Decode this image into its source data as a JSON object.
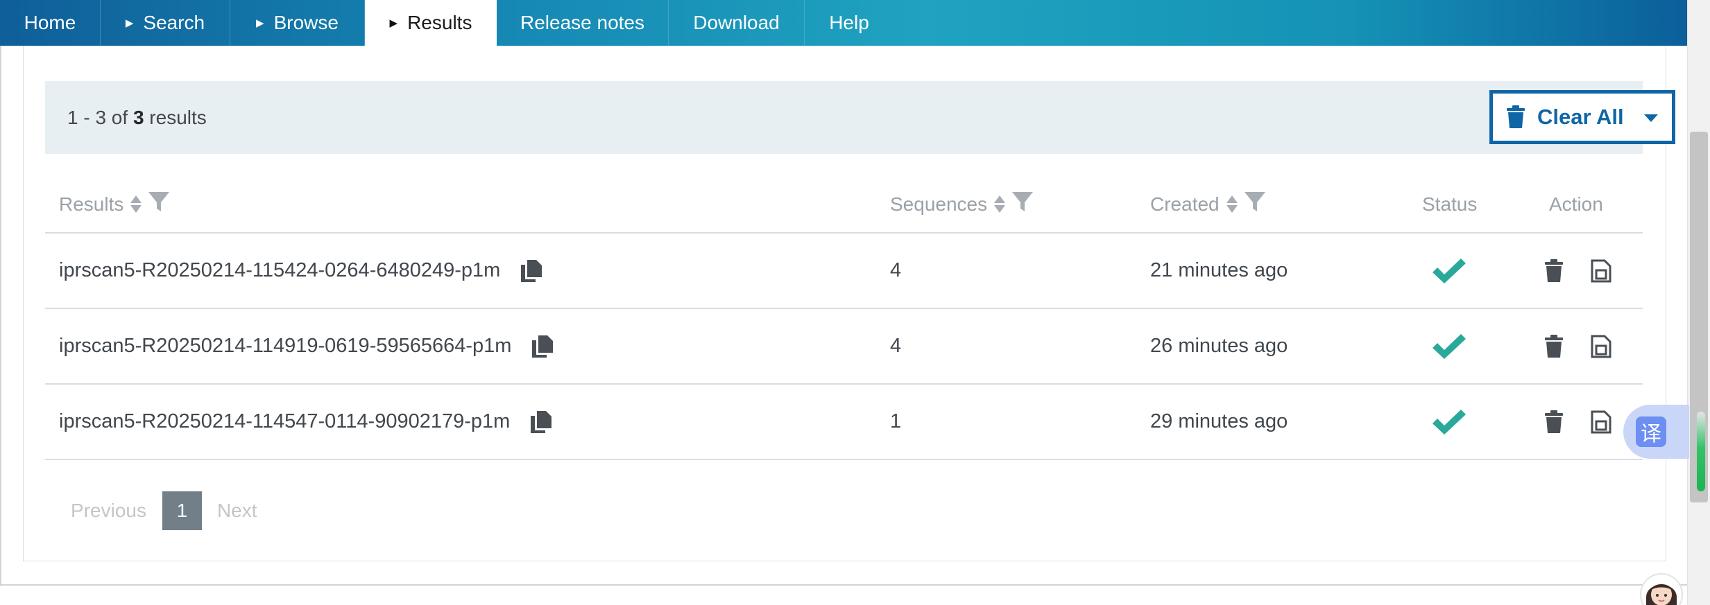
{
  "nav": {
    "items": [
      {
        "label": "Home",
        "has_arrow": false
      },
      {
        "label": "Search",
        "has_arrow": true
      },
      {
        "label": "Browse",
        "has_arrow": true
      },
      {
        "label": "Results",
        "has_arrow": true,
        "active": true
      },
      {
        "label": "Release notes",
        "has_arrow": false
      },
      {
        "label": "Download",
        "has_arrow": false
      },
      {
        "label": "Help",
        "has_arrow": false
      }
    ]
  },
  "summary": {
    "range_prefix": "1 - 3 of ",
    "total": "3",
    "suffix": " results",
    "clear_all_label": "Clear All"
  },
  "table": {
    "headers": {
      "results": "Results",
      "sequences": "Sequences",
      "created": "Created",
      "status": "Status",
      "action": "Action"
    },
    "rows": [
      {
        "id": "iprscan5-R20250214-115424-0264-6480249-p1m",
        "sequences": "4",
        "created": "21 minutes ago",
        "status": "success"
      },
      {
        "id": "iprscan5-R20250214-114919-0619-59565664-p1m",
        "sequences": "4",
        "created": "26 minutes ago",
        "status": "success"
      },
      {
        "id": "iprscan5-R20250214-114547-0114-90902179-p1m",
        "sequences": "1",
        "created": "29 minutes ago",
        "status": "success"
      }
    ]
  },
  "pagination": {
    "previous": "Previous",
    "current": "1",
    "next": "Next"
  },
  "widgets": {
    "translate_glyph": "译"
  },
  "colors": {
    "accent": "#0f66a6",
    "check": "#28a99a",
    "summary_bg": "#e8eff2",
    "page_active": "#737f88"
  },
  "icons": [
    "trash-icon",
    "caret-down-icon",
    "sort-icon",
    "filter-icon",
    "copy-icon",
    "check-icon",
    "delete-icon",
    "save-icon",
    "translate-icon",
    "avatar"
  ]
}
